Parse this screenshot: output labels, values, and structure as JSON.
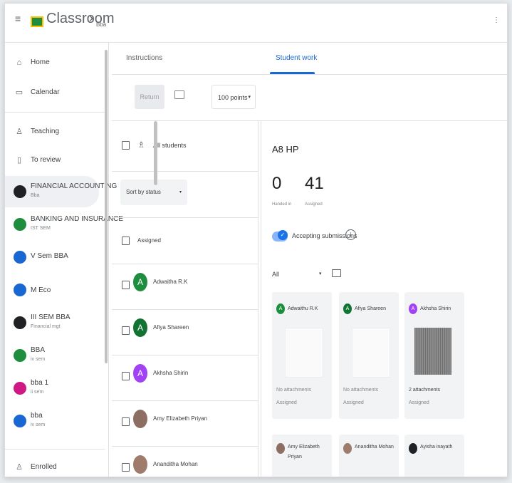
{
  "header": {
    "title": "Classroom",
    "separator": "›",
    "class_code": "Bba",
    "menu_icon": "menu-icon",
    "apps_icon": "apps-icon"
  },
  "sidebar": {
    "items": [
      {
        "label": "Home",
        "icon": "home-icon"
      },
      {
        "label": "Calendar",
        "icon": "calendar-icon"
      },
      {
        "label": "Teaching",
        "icon": "people-icon"
      },
      {
        "label": "To review",
        "icon": "review-icon"
      }
    ],
    "classes": [
      {
        "label": "FINANCIAL ACCOUNTING",
        "sub": "Bba",
        "color": "#202124"
      },
      {
        "label": "BANKING AND INSURANCE",
        "sub": "IST SEM",
        "color": "#1e8e3e"
      },
      {
        "label": "V Sem BBA",
        "sub": "",
        "color": "#1967d2"
      },
      {
        "label": "M Eco",
        "sub": "",
        "color": "#1967d2"
      },
      {
        "label": "III SEM BBA",
        "sub": "Financial mgt",
        "color": "#202124"
      },
      {
        "label": "BBA",
        "sub": "iv sem",
        "color": "#1e8e3e"
      },
      {
        "label": "bba 1",
        "sub": "ii sem",
        "color": "#d01884"
      },
      {
        "label": "bba",
        "sub": "iv sem",
        "color": "#1967d2"
      }
    ],
    "enrolled": {
      "label": "Enrolled",
      "icon": "enrolled-icon"
    }
  },
  "tabs": [
    {
      "label": "Instructions"
    },
    {
      "label": "Student work"
    }
  ],
  "toolbar": {
    "return_label": "Return",
    "points_label": "100 points",
    "points_arrow": "▾"
  },
  "list": {
    "all_students": "All students",
    "sort_label": "Sort by status",
    "sort_arrow": "▾",
    "assigned_header": "Assigned",
    "students": [
      {
        "name": "Adwaitha R.K",
        "initial": "A",
        "color": "#1e8e3e"
      },
      {
        "name": "Afiya Shareen",
        "initial": "A",
        "color": "#137333"
      },
      {
        "name": "Akhsha Shirin",
        "initial": "A",
        "color": "#a142f4"
      },
      {
        "name": "Amy Elizabeth Priyan",
        "initial": "",
        "color": "#8d6e63"
      },
      {
        "name": "Ananditha Mohan",
        "initial": "",
        "color": "#9e7b6b"
      }
    ]
  },
  "detail": {
    "title": "A8 HP",
    "handed_in": "0",
    "handed_in_label": "Handed in",
    "assigned": "41",
    "assigned_label": "Assigned",
    "accepting_label": "Accepting submissions",
    "filter_label": "All",
    "filter_arrow": "▾",
    "cards": [
      {
        "name": "Adwaithu R.K",
        "initial": "A",
        "color": "#1e8e3e",
        "attachments": "No attachments",
        "status": "Assigned"
      },
      {
        "name": "Afiya Shareen",
        "initial": "A",
        "color": "#137333",
        "attachments": "No attachments",
        "status": "Assigned"
      },
      {
        "name": "Akhsha Shirin",
        "initial": "A",
        "color": "#a142f4",
        "attachments": "2 attachments",
        "status": "Assigned"
      }
    ],
    "cards2": [
      {
        "name": "Amy Elizabeth",
        "name2": "Priyan",
        "color": "#8d6e63"
      },
      {
        "name": "Ananditha Mohan",
        "name2": "",
        "color": "#9e7b6b"
      },
      {
        "name": "Ayisha inayath",
        "name2": "",
        "color": "#202124"
      }
    ]
  }
}
